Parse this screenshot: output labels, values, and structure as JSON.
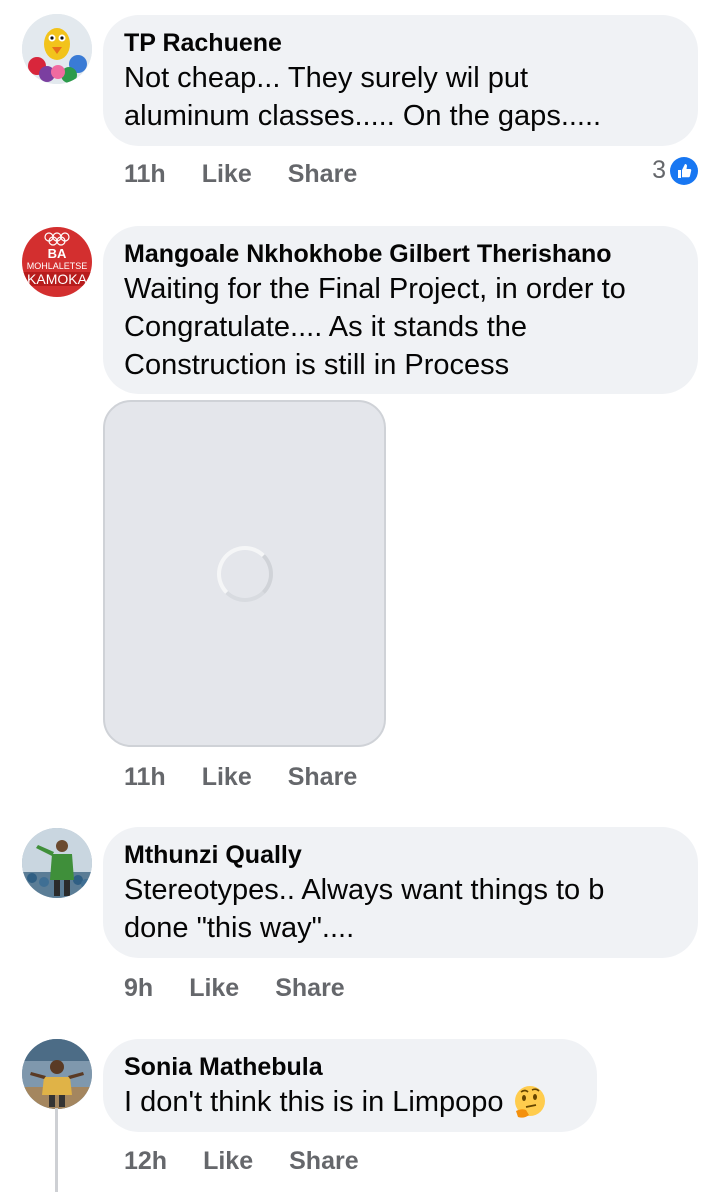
{
  "comments": [
    {
      "author": "TP Rachuene",
      "text_lines": [
        "Not cheap... They surely wil put",
        "aluminum classes..... On the gaps....."
      ],
      "time": "11h",
      "like_label": "Like",
      "share_label": "Share",
      "reaction_count": "3",
      "avatar_icon": "muppet-avatar-icon"
    },
    {
      "author": "Mangoale Nkhokhobe Gilbert Therishano",
      "text_lines": [
        "Waiting for the Final Project, in order to",
        "Congratulate.... As it stands the",
        "Construction is still in Process"
      ],
      "time": "11h",
      "like_label": "Like",
      "share_label": "Share",
      "avatar_text": [
        "BA",
        "MOHLALETSE",
        "KAMOKA"
      ],
      "avatar_icon": "olympic-rings-icon",
      "attachment": "loading-image"
    },
    {
      "author": "Mthunzi Qually",
      "text_lines": [
        "Stereotypes.. Always want things to b",
        "done \"this way\"...."
      ],
      "time": "9h",
      "like_label": "Like",
      "share_label": "Share",
      "avatar_icon": "person-photo-avatar-icon"
    },
    {
      "author": "Sonia Mathebula",
      "text_lines": [
        "I don't think this is in Limpopo"
      ],
      "emoji": "thinking-face-icon",
      "time": "12h",
      "like_label": "Like",
      "share_label": "Share",
      "avatar_icon": "person-photo-avatar-icon"
    }
  ],
  "colors": {
    "bubble": "#f0f2f5",
    "secondary_text": "#65676b",
    "like_blue": "#1877f2",
    "avatar_red": "#d32f2f"
  }
}
